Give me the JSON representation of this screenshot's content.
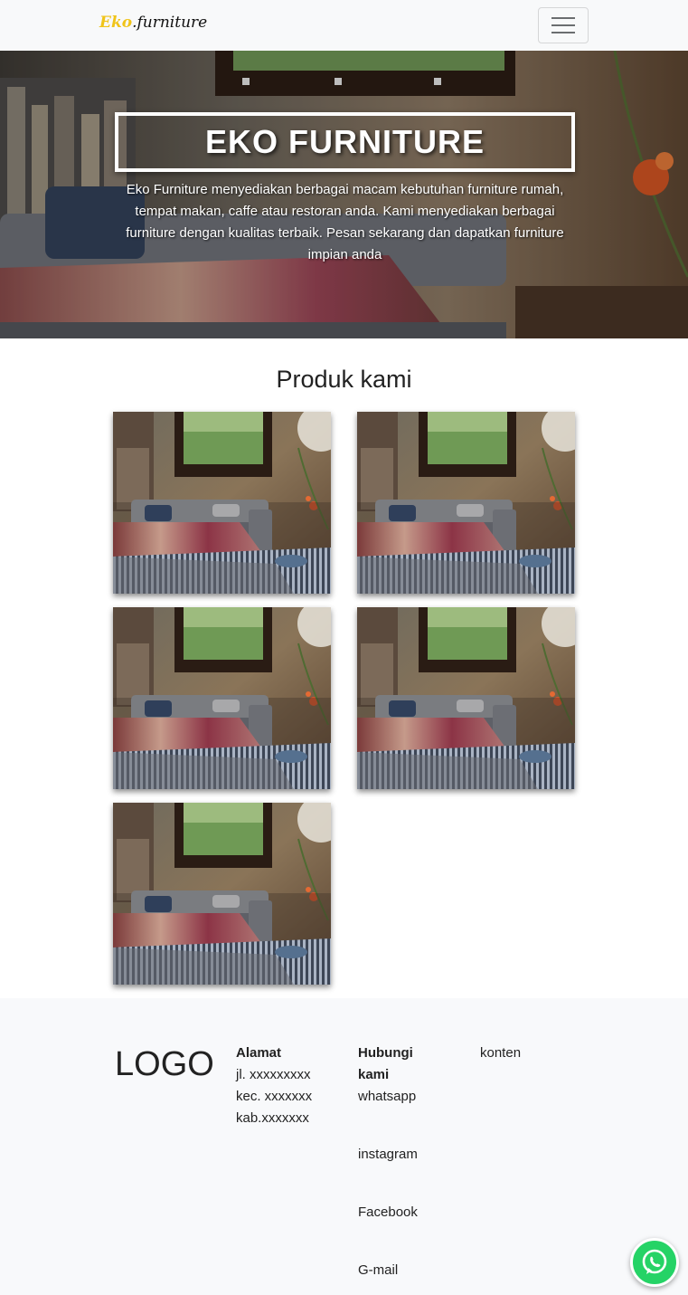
{
  "navbar": {
    "brand_part1": "Eko",
    "brand_part2": ".furniture",
    "toggler_icon": "menu-icon"
  },
  "hero": {
    "title": "EKO FURNITURE",
    "description": "Eko Furniture menyediakan berbagai macam kebutuhan furniture rumah, tempat makan, caffe atau restoran anda. Kami menyediakan berbagai furniture dengan kualitas terbaik. Pesan sekarang dan dapatkan furniture impian anda"
  },
  "products": {
    "title": "Produk kami",
    "count": 5
  },
  "footer": {
    "logo": "LOGO",
    "address": {
      "heading": "Alamat",
      "lines": [
        "jl. xxxxxxxxx",
        "kec. xxxxxxx",
        "kab.xxxxxxx"
      ]
    },
    "contact": {
      "heading_line1": "Hubungi",
      "heading_line2": "kami",
      "items": [
        "whatsapp",
        "instagram",
        "Facebook",
        "G-mail"
      ]
    },
    "content": "konten"
  },
  "colors": {
    "navbar_bg": "#f8f9fa",
    "brand_accent": "#f0c419",
    "whatsapp": "#25d366",
    "footer_bg": "#f8f9fb"
  },
  "floating_button_icon": "whatsapp-icon"
}
